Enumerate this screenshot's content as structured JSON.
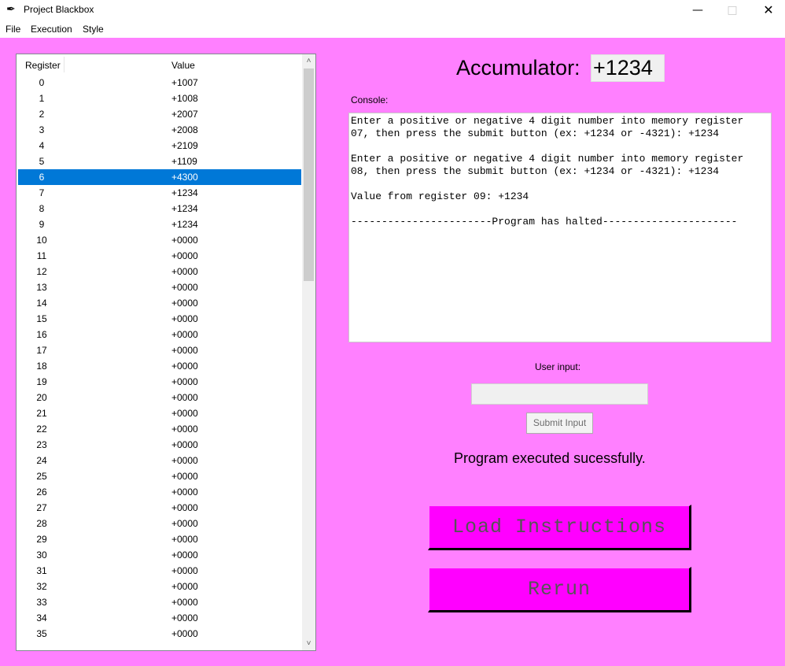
{
  "window": {
    "title": "Project Blackbox",
    "icon": "feather-icon",
    "min": "—",
    "max": "□",
    "close": "✕"
  },
  "menu": [
    "File",
    "Execution",
    "Style"
  ],
  "registers": {
    "headers": {
      "register": "Register",
      "value": "Value"
    },
    "selected_index": 6,
    "rows": [
      {
        "reg": "0",
        "val": "+1007"
      },
      {
        "reg": "1",
        "val": "+1008"
      },
      {
        "reg": "2",
        "val": "+2007"
      },
      {
        "reg": "3",
        "val": "+2008"
      },
      {
        "reg": "4",
        "val": "+2109"
      },
      {
        "reg": "5",
        "val": "+1109"
      },
      {
        "reg": "6",
        "val": "+4300"
      },
      {
        "reg": "7",
        "val": "+1234"
      },
      {
        "reg": "8",
        "val": "+1234"
      },
      {
        "reg": "9",
        "val": "+1234"
      },
      {
        "reg": "10",
        "val": "+0000"
      },
      {
        "reg": "11",
        "val": "+0000"
      },
      {
        "reg": "12",
        "val": "+0000"
      },
      {
        "reg": "13",
        "val": "+0000"
      },
      {
        "reg": "14",
        "val": "+0000"
      },
      {
        "reg": "15",
        "val": "+0000"
      },
      {
        "reg": "16",
        "val": "+0000"
      },
      {
        "reg": "17",
        "val": "+0000"
      },
      {
        "reg": "18",
        "val": "+0000"
      },
      {
        "reg": "19",
        "val": "+0000"
      },
      {
        "reg": "20",
        "val": "+0000"
      },
      {
        "reg": "21",
        "val": "+0000"
      },
      {
        "reg": "22",
        "val": "+0000"
      },
      {
        "reg": "23",
        "val": "+0000"
      },
      {
        "reg": "24",
        "val": "+0000"
      },
      {
        "reg": "25",
        "val": "+0000"
      },
      {
        "reg": "26",
        "val": "+0000"
      },
      {
        "reg": "27",
        "val": "+0000"
      },
      {
        "reg": "28",
        "val": "+0000"
      },
      {
        "reg": "29",
        "val": "+0000"
      },
      {
        "reg": "30",
        "val": "+0000"
      },
      {
        "reg": "31",
        "val": "+0000"
      },
      {
        "reg": "32",
        "val": "+0000"
      },
      {
        "reg": "33",
        "val": "+0000"
      },
      {
        "reg": "34",
        "val": "+0000"
      },
      {
        "reg": "35",
        "val": "+0000"
      }
    ]
  },
  "accumulator": {
    "label": "Accumulator:",
    "value": "+1234"
  },
  "console": {
    "label": "Console:",
    "text": "Enter a positive or negative 4 digit number into memory register\n07, then press the submit button (ex: +1234 or -4321): +1234\n\nEnter a positive or negative 4 digit number into memory register\n08, then press the submit button (ex: +1234 or -4321): +1234\n\nValue from register 09: +1234\n\n-----------------------Program has halted----------------------"
  },
  "user_input": {
    "label": "User input:",
    "value": "",
    "submit_label": "Submit Input"
  },
  "status": "Program executed sucessfully.",
  "buttons": {
    "load": "Load Instructions",
    "rerun": "Rerun"
  },
  "colors": {
    "background": "#ff80ff",
    "button": "#ff00ff",
    "selection": "#0078d7"
  }
}
